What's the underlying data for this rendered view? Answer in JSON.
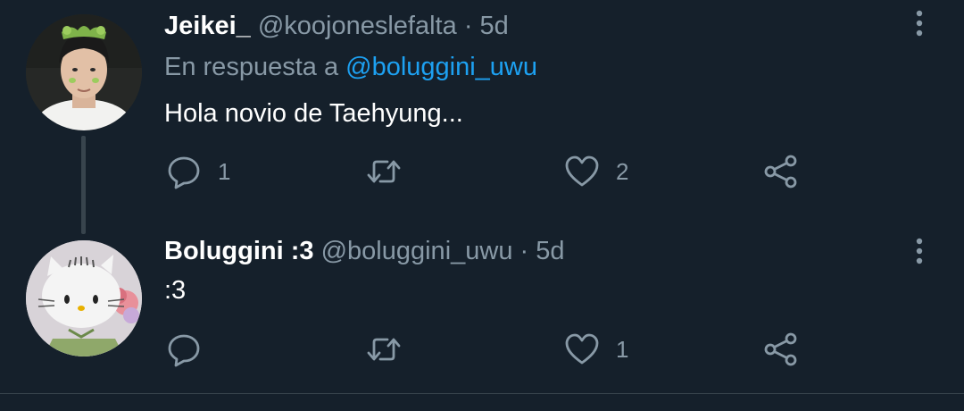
{
  "colors": {
    "background": "#15202b",
    "secondary_text": "#8899a6",
    "accent": "#1da1f2",
    "divider": "#38444d"
  },
  "tweets": [
    {
      "display_name": "Jeikei_",
      "handle": "@koojoneslefalta",
      "separator": "·",
      "time": "5d",
      "reply_prefix": "En respuesta a",
      "reply_mention": "@boluggini_uwu",
      "text": "Hola novio de Taehyung...",
      "avatar_icon": "person-photo-avatar",
      "replies": "1",
      "retweets": "",
      "likes": "2"
    },
    {
      "display_name": "Boluggini :3",
      "handle": "@boluggini_uwu",
      "separator": "·",
      "time": "5d",
      "text": ":3",
      "avatar_icon": "hello-kitty-avatar",
      "replies": "",
      "retweets": "",
      "likes": "1"
    }
  ],
  "icons": {
    "more": "more-vertical-icon",
    "reply": "reply-bubble-icon",
    "retweet": "retweet-icon",
    "like": "heart-icon",
    "share": "share-icon"
  }
}
